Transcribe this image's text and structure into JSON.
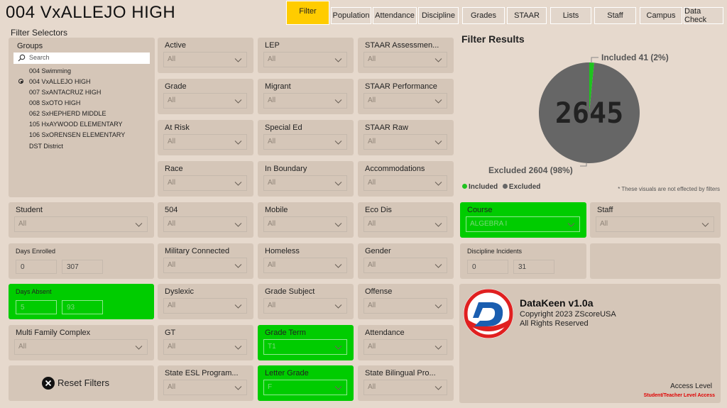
{
  "app": {
    "title": "004 VxALLEJO HIGH"
  },
  "tabs": [
    {
      "label": "Filter",
      "active": true
    },
    {
      "label": "Population"
    },
    {
      "label": "Attendance"
    },
    {
      "label": "Discipline"
    },
    {
      "label": "Grades"
    },
    {
      "label": "STAAR"
    },
    {
      "label": "Lists"
    },
    {
      "label": "Staff"
    },
    {
      "label": "Campus"
    },
    {
      "label": "Data Check"
    }
  ],
  "filter_selectors_label": "Filter Selectors",
  "groups": {
    "label": "Groups",
    "search_placeholder": "Search",
    "items": [
      {
        "label": "004 Swimming",
        "selected": false
      },
      {
        "label": "004 VxALLEJO HIGH",
        "selected": true
      },
      {
        "label": "007 SxANTACRUZ HIGH",
        "selected": false
      },
      {
        "label": "008 SxOTO HIGH",
        "selected": false
      },
      {
        "label": "062 SxHEPHERD MIDDLE",
        "selected": false
      },
      {
        "label": "105 HxAYWOOD ELEMENTARY",
        "selected": false
      },
      {
        "label": "106 SxORENSEN ELEMENTARY",
        "selected": false
      },
      {
        "label": "DST District",
        "selected": false
      }
    ]
  },
  "filters": {
    "active": {
      "label": "Active",
      "value": "All"
    },
    "lep": {
      "label": "LEP",
      "value": "All"
    },
    "staar_assessment": {
      "label": "STAAR Assessmen...",
      "value": "All"
    },
    "grade": {
      "label": "Grade",
      "value": "All"
    },
    "migrant": {
      "label": "Migrant",
      "value": "All"
    },
    "staar_performance": {
      "label": "STAAR Performance",
      "value": "All"
    },
    "at_risk": {
      "label": "At Risk",
      "value": "All"
    },
    "special_ed": {
      "label": "Special Ed",
      "value": "All"
    },
    "staar_raw": {
      "label": "STAAR Raw",
      "value": "All"
    },
    "race": {
      "label": "Race",
      "value": "All"
    },
    "in_boundary": {
      "label": "In Boundary",
      "value": "All"
    },
    "accommodations": {
      "label": "Accommodations",
      "value": "All"
    },
    "student": {
      "label": "Student",
      "value": "All"
    },
    "f504": {
      "label": "504",
      "value": "All"
    },
    "mobile": {
      "label": "Mobile",
      "value": "All"
    },
    "eco_dis": {
      "label": "Eco Dis",
      "value": "All"
    },
    "military": {
      "label": "Military Connected",
      "value": "All"
    },
    "homeless": {
      "label": "Homeless",
      "value": "All"
    },
    "gender": {
      "label": "Gender",
      "value": "All"
    },
    "dyslexic": {
      "label": "Dyslexic",
      "value": "All"
    },
    "grade_subject": {
      "label": "Grade Subject",
      "value": "All"
    },
    "offense": {
      "label": "Offense",
      "value": "All"
    },
    "multi_family": {
      "label": "Multi Family Complex",
      "value": "All"
    },
    "gt": {
      "label": "GT",
      "value": "All"
    },
    "grade_term": {
      "label": "Grade Term",
      "value": "T1"
    },
    "attendance": {
      "label": "Attendance",
      "value": "All"
    },
    "state_esl": {
      "label": "State ESL Program...",
      "value": "All"
    },
    "letter_grade": {
      "label": "Letter Grade",
      "value": "F"
    },
    "state_bilingual": {
      "label": "State Bilingual Pro...",
      "value": "All"
    },
    "course": {
      "label": "Course",
      "value": "ALGEBRA I"
    },
    "staff": {
      "label": "Staff",
      "value": "All"
    }
  },
  "ranges": {
    "days_enrolled": {
      "label": "Days Enrolled",
      "min": "0",
      "max": "307"
    },
    "days_absent": {
      "label": "Days Absent",
      "min": "5",
      "max": "93"
    },
    "discipline_incidents": {
      "label": "Discipline Incidents",
      "min": "0",
      "max": "31"
    }
  },
  "reset_label": "Reset Filters",
  "results": {
    "title": "Filter Results",
    "total": "2645",
    "included_label": "Included 41 (2%)",
    "excluded_label": "Excluded 2604 (98%)",
    "legend_included": "Included",
    "legend_excluded": "Excluded",
    "note": "* These visuals are not effected by filters"
  },
  "chart_data": {
    "type": "pie",
    "slices": [
      {
        "name": "Included",
        "value": 41,
        "color": "#1ec31e"
      },
      {
        "name": "Excluded",
        "value": 2604,
        "color": "#666666"
      }
    ],
    "center_label": "2645",
    "data_labels": [
      "Included 41 (2%)",
      "Excluded 2604 (98%)"
    ],
    "legend": [
      "Included",
      "Excluded"
    ]
  },
  "about": {
    "title": "DataKeen v1.0a",
    "copyright": "Copyright 2023 ZScoreUSA",
    "rights": "All Rights Reserved",
    "access_label": "Access Level",
    "access_value": "Student/Teacher Level Access"
  },
  "colors": {
    "background": "#e6d9cd",
    "tile": "#d5c6b8",
    "active_filter": "#00cc00",
    "active_tab": "#ffcc00",
    "access_text": "#e00000"
  }
}
